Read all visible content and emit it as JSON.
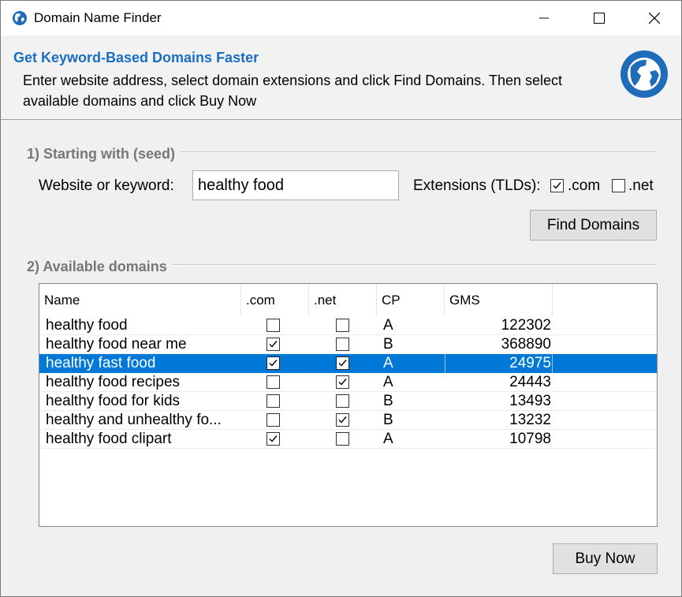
{
  "window": {
    "title": "Domain Name Finder"
  },
  "header": {
    "title": "Get Keyword-Based Domains Faster",
    "description": "Enter website address, select domain extensions and click Find Domains. Then select available domains and click Buy Now"
  },
  "seed": {
    "group_title": "1) Starting with (seed)",
    "keyword_label": "Website or keyword:",
    "keyword_value": "healthy food",
    "extensions_label": "Extensions (TLDs):",
    "ext_com_label": ".com",
    "ext_com_checked": true,
    "ext_net_label": ".net",
    "ext_net_checked": false,
    "find_button": "Find Domains"
  },
  "results": {
    "group_title": "2) Available domains",
    "columns": [
      "Name",
      ".com",
      ".net",
      "CP",
      "GMS"
    ],
    "rows": [
      {
        "name": "healthy food",
        "com": false,
        "net": false,
        "cp": "A",
        "gms": "122302",
        "selected": false
      },
      {
        "name": "healthy food near me",
        "com": true,
        "net": false,
        "cp": "B",
        "gms": "368890",
        "selected": false
      },
      {
        "name": "healthy fast food",
        "com": true,
        "net": true,
        "cp": "A",
        "gms": "24975",
        "selected": true
      },
      {
        "name": "healthy food recipes",
        "com": false,
        "net": true,
        "cp": "A",
        "gms": "24443",
        "selected": false
      },
      {
        "name": "healthy food for kids",
        "com": false,
        "net": false,
        "cp": "B",
        "gms": "13493",
        "selected": false
      },
      {
        "name": "healthy and unhealthy fo...",
        "com": false,
        "net": true,
        "cp": "B",
        "gms": "13232",
        "selected": false
      },
      {
        "name": "healthy food clipart",
        "com": true,
        "net": false,
        "cp": "A",
        "gms": "10798",
        "selected": false
      }
    ]
  },
  "buy_button": "Buy Now",
  "colors": {
    "accent": "#0078d7",
    "title": "#1a6fc2",
    "globe": "#1f6cb8"
  },
  "icons": {
    "app": "globe-icon",
    "header": "globe-icon",
    "check": "check-icon"
  }
}
